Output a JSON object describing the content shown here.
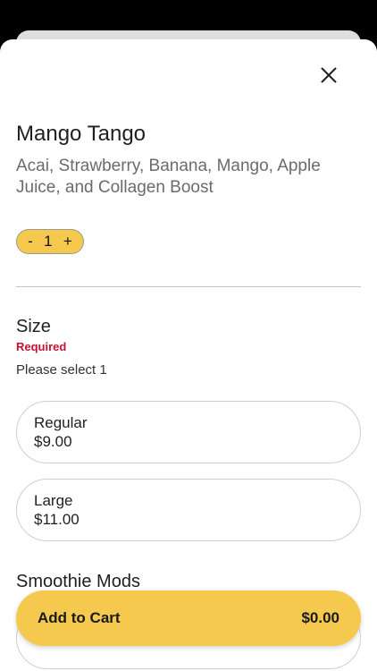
{
  "item": {
    "title": "Mango Tango",
    "description": "Acai, Strawberry, Banana, Mango, Apple Juice, and Collagen Boost"
  },
  "quantity": {
    "minus_label": "-",
    "value": "1",
    "plus_label": "+"
  },
  "size_section": {
    "title": "Size",
    "required_label": "Required",
    "helper_text": "Please select 1",
    "options": [
      {
        "name": "Regular",
        "price": "$9.00"
      },
      {
        "name": "Large",
        "price": "$11.00"
      }
    ]
  },
  "mods_section": {
    "title": "Smoothie Mods"
  },
  "cart": {
    "label": "Add to Cart",
    "total": "$0.00"
  },
  "colors": {
    "accent": "#f4c94e",
    "required": "#c8102e"
  },
  "icons": {
    "close": "close-icon"
  }
}
